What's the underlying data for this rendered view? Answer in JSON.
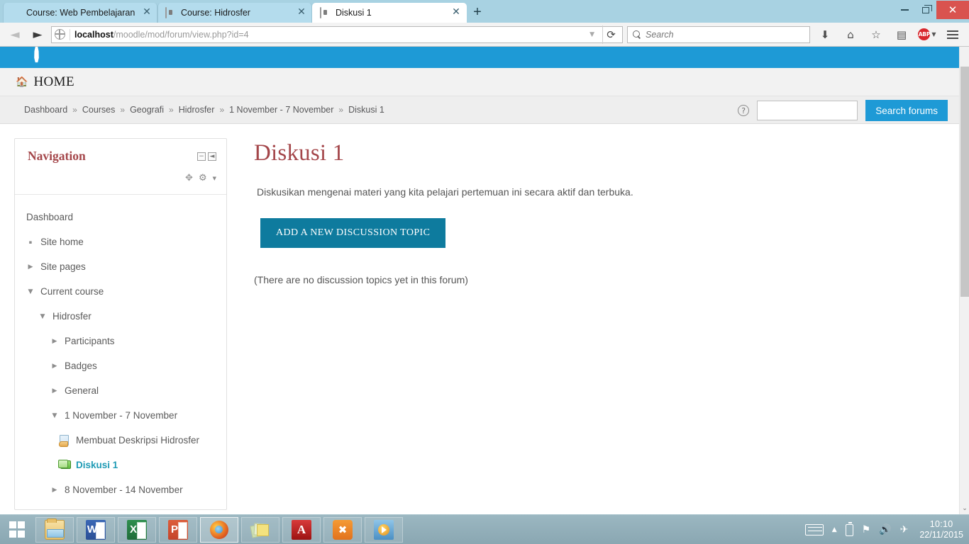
{
  "browser": {
    "tabs": [
      {
        "title": "Course: Web Pembelajaran",
        "favicon": "moodle-favicon",
        "close": "✕",
        "active": false,
        "has_favicon": false
      },
      {
        "title": "Course: Hidrosfer",
        "favicon": "moodle-favicon",
        "close": "✕",
        "active": false,
        "has_favicon": true
      },
      {
        "title": "Diskusi 1",
        "favicon": "moodle-favicon",
        "close": "✕",
        "active": true,
        "has_favicon": true
      }
    ],
    "new_tab_label": "+",
    "window_controls": {
      "minimize": "minimize-icon",
      "restore": "restore-icon",
      "close": "✕"
    },
    "nav": {
      "back": "◄",
      "forward": "►",
      "reload": "⟳",
      "url_host": "localhost",
      "url_path": "/moodle/mod/forum/view.php?id=4",
      "url_dropdown": "▼"
    },
    "search": {
      "placeholder": "Search",
      "icon": "search-icon"
    },
    "toolbar_icons": [
      {
        "name": "download-icon",
        "glyph": "⬇"
      },
      {
        "name": "home-icon",
        "glyph": "⌂"
      },
      {
        "name": "bookmark-star-icon",
        "glyph": "☆"
      },
      {
        "name": "library-icon",
        "glyph": "▤"
      }
    ],
    "adblock": {
      "label": "ABP",
      "caret": "▼"
    },
    "menu_icon": "hamburger-menu-icon"
  },
  "site": {
    "home_label": "HOME",
    "home_icon": "home-icon",
    "breadcrumb": [
      "Dashboard",
      "Courses",
      "Geografi",
      "Hidrosfer",
      "1 November - 7 November",
      "Diskusi 1"
    ],
    "breadcrumb_separator": "»",
    "search_forums": {
      "help_icon": "help-icon",
      "help_glyph": "?",
      "input_value": "",
      "button_label": "Search forums"
    },
    "accent_blue": "#1e9ad6",
    "heading_red": "#a4464a"
  },
  "sidebar": {
    "title": "Navigation",
    "controls": [
      {
        "name": "dock-collapse-icon",
        "glyph": "−"
      },
      {
        "name": "dock-block-icon",
        "glyph": "◄"
      }
    ],
    "actions": [
      {
        "name": "move-block-icon",
        "glyph": "✥"
      },
      {
        "name": "block-settings-gear-icon",
        "glyph": "⚙"
      },
      {
        "name": "chevron-down-icon",
        "glyph": "▼"
      }
    ],
    "items": [
      {
        "label": "Dashboard",
        "indent": 0,
        "twisty": "none",
        "icon": "none",
        "active": false
      },
      {
        "label": "Site home",
        "indent": 1,
        "twisty": "square",
        "icon": "none",
        "active": false
      },
      {
        "label": "Site pages",
        "indent": 1,
        "twisty": "closed",
        "icon": "none",
        "active": false
      },
      {
        "label": "Current course",
        "indent": 1,
        "twisty": "open",
        "icon": "none",
        "active": false
      },
      {
        "label": "Hidrosfer",
        "indent": 2,
        "twisty": "open",
        "icon": "none",
        "active": false
      },
      {
        "label": "Participants",
        "indent": 3,
        "twisty": "closed",
        "icon": "none",
        "active": false
      },
      {
        "label": "Badges",
        "indent": 3,
        "twisty": "closed",
        "icon": "none",
        "active": false
      },
      {
        "label": "General",
        "indent": 3,
        "twisty": "closed",
        "icon": "none",
        "active": false
      },
      {
        "label": "1 November - 7 November",
        "indent": 3,
        "twisty": "open",
        "icon": "none",
        "active": false
      },
      {
        "label": "Membuat Deskripsi Hidrosfer",
        "indent": 4,
        "twisty": "none",
        "icon": "page-resource-icon",
        "active": false
      },
      {
        "label": "Diskusi 1",
        "indent": 4,
        "twisty": "none",
        "icon": "forum-icon",
        "active": true
      },
      {
        "label": "8 November - 14 November",
        "indent": 3,
        "twisty": "closed",
        "icon": "none",
        "active": false
      }
    ],
    "twisty_glyphs": {
      "closed": "▶",
      "open": "▼",
      "square": "▪"
    }
  },
  "main": {
    "title": "Diskusi 1",
    "intro": "Diskusikan mengenai materi yang kita pelajari pertemuan ini secara aktif dan terbuka.",
    "add_button_label": "ADD A NEW DISCUSSION TOPIC",
    "empty_message": "(There are no discussion topics yet in this forum)"
  },
  "scrollbar": {
    "down_arrow": "⌄"
  },
  "taskbar": {
    "start_label": "start-button",
    "apps": [
      {
        "name": "file-explorer",
        "icon": "folder-icon",
        "active": false,
        "letter": ""
      },
      {
        "name": "word",
        "icon": "word-icon",
        "active": false,
        "letter": "W"
      },
      {
        "name": "excel",
        "icon": "excel-icon",
        "active": false,
        "letter": "X"
      },
      {
        "name": "powerpoint",
        "icon": "powerpoint-icon",
        "active": false,
        "letter": "P"
      },
      {
        "name": "firefox",
        "icon": "firefox-icon",
        "active": true,
        "letter": ""
      },
      {
        "name": "sticky-notes",
        "icon": "sticky-notes-icon",
        "active": false,
        "letter": ""
      },
      {
        "name": "adobe-reader",
        "icon": "pdf-icon",
        "active": false,
        "letter": "A"
      },
      {
        "name": "xampp",
        "icon": "xampp-icon",
        "active": false,
        "letter": ""
      },
      {
        "name": "media-player",
        "icon": "media-player-icon",
        "active": false,
        "letter": ""
      }
    ],
    "tray": {
      "keyboard_icon": "keyboard-icon",
      "show_hidden": "▲",
      "battery_icon": "battery-icon",
      "action_center": "⚑",
      "volume": "🔊",
      "airplane": "✈",
      "time": "10:10",
      "date": "22/11/2015"
    }
  }
}
